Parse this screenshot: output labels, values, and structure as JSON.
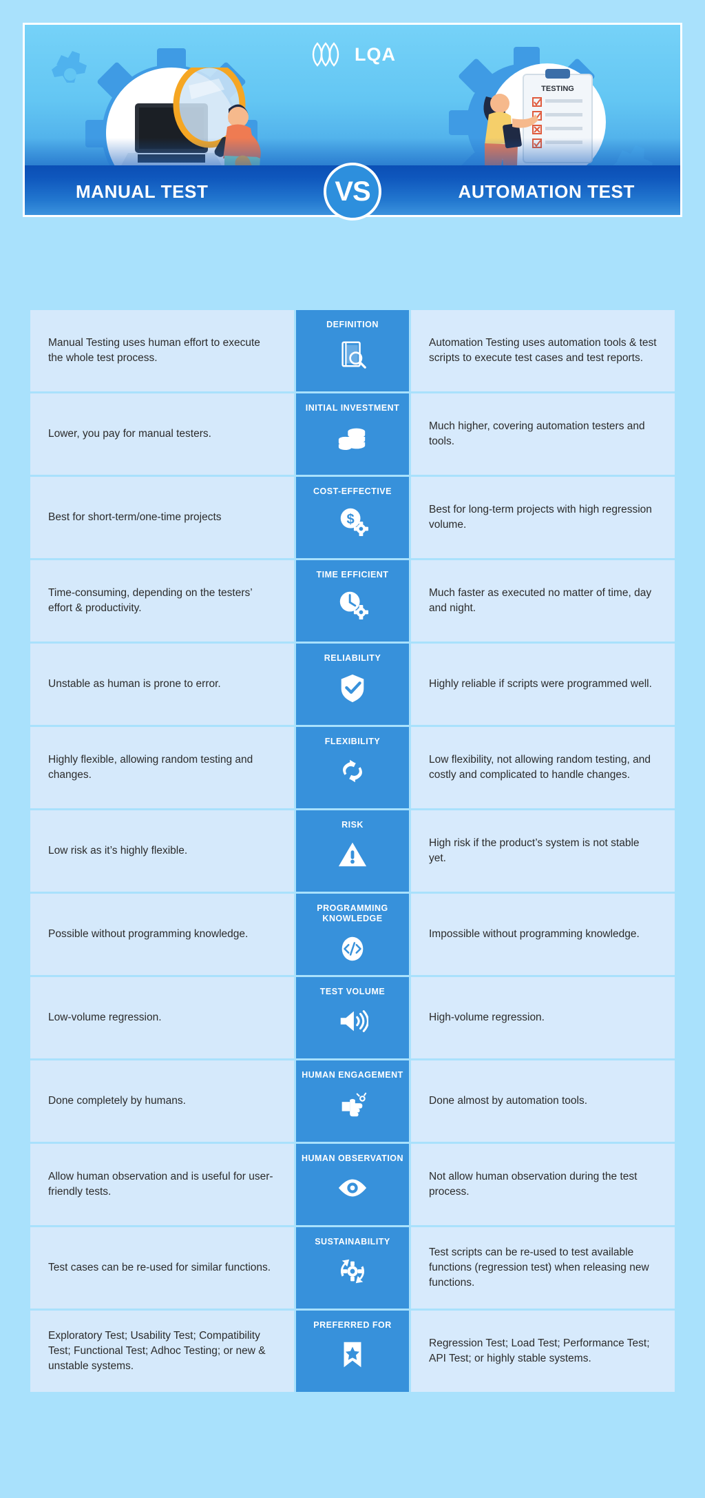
{
  "brand": {
    "name": "LQA",
    "logo_icon": "lqa-leaves-logo"
  },
  "hero": {
    "left_title": "MANUAL TEST",
    "right_title": "AUTOMATION TEST",
    "vs_label": "VS",
    "colors": {
      "band": "#0f57bd",
      "accent": "#2d8fdd",
      "sky": "#63c6f3"
    }
  },
  "table": {
    "colors": {
      "mid_cell": "#3791db",
      "side_cell": "#d5e9fb"
    },
    "rows": [
      {
        "label": "DEFINITION",
        "icon": "book-magnifier-icon",
        "manual": "Manual Testing uses human effort to execute the whole test process.",
        "automation": "Automation Testing uses automation tools & test scripts to execute test cases and test reports."
      },
      {
        "label": "INITIAL INVESTMENT",
        "icon": "coins-stack-icon",
        "manual": "Lower, you pay for manual testers.",
        "automation": "Much higher, covering automation testers and tools."
      },
      {
        "label": "COST-EFFECTIVE",
        "icon": "dollar-gear-icon",
        "manual": "Best for short-term/one-time projects",
        "automation": "Best for long-term projects with high regression volume."
      },
      {
        "label": "TIME EFFICIENT",
        "icon": "clock-gear-icon",
        "manual": "Time-consuming, depending on the testers’ effort & productivity.",
        "automation": "Much faster as executed no matter of time, day and night."
      },
      {
        "label": "RELIABILITY",
        "icon": "shield-check-icon",
        "manual": "Unstable as human is prone to error.",
        "automation": "Highly reliable if scripts were programmed well."
      },
      {
        "label": "FLEXIBILITY",
        "icon": "flex-arrows-icon",
        "manual": "Highly flexible, allowing random testing and changes.",
        "automation": "Low flexibility, not allowing random testing, and costly and complicated to handle changes."
      },
      {
        "label": "RISK",
        "icon": "warning-triangle-icon",
        "manual": "Low risk as it’s highly flexible.",
        "automation": "High risk if the product’s system is not stable yet."
      },
      {
        "label": "PROGRAMMING KNOWLEDGE",
        "icon": "code-brackets-icon",
        "manual": "Possible without programming knowledge.",
        "automation": "Impossible without programming knowledge."
      },
      {
        "label": "TEST VOLUME",
        "icon": "speaker-volume-icon",
        "manual": "Low-volume regression.",
        "automation": "High-volume regression."
      },
      {
        "label": "HUMAN ENGAGEMENT",
        "icon": "pointing-hand-icon",
        "manual": "Done completely by humans.",
        "automation": "Done almost by automation tools."
      },
      {
        "label": "HUMAN OBSERVATION",
        "icon": "eye-icon",
        "manual": "Allow human observation and is useful for user-friendly tests.",
        "automation": "Not allow human observation during the test process."
      },
      {
        "label": "SUSTAINABILITY",
        "icon": "recycle-gear-icon",
        "manual": "Test cases can be re-used for similar functions.",
        "automation": "Test scripts can be re-used to test available functions (regression test) when releasing new functions."
      },
      {
        "label": "PREFERRED FOR",
        "icon": "bookmark-star-icon",
        "manual": "Exploratory Test; Usability Test; Compatibility Test; Functional Test; Adhoc Testing; or new & unstable systems.",
        "automation": "Regression Test; Load Test; Performance Test; API Test; or highly stable systems."
      }
    ]
  }
}
